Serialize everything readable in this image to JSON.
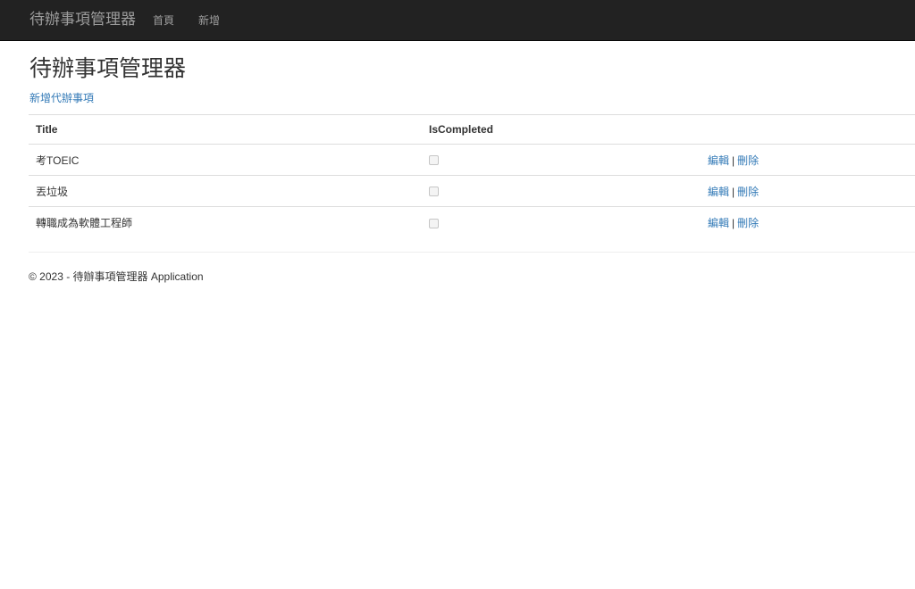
{
  "navbar": {
    "brand": "待辦事項管理器",
    "links": [
      "首頁",
      "新增"
    ]
  },
  "page": {
    "title": "待辦事項管理器",
    "create_link": "新增代辦事項"
  },
  "table": {
    "headers": [
      "Title",
      "IsCompleted"
    ],
    "rows": [
      {
        "title": "考TOEIC",
        "is_completed": false,
        "edit": "編輯",
        "sep": "|",
        "delete": "刪除"
      },
      {
        "title": "丟垃圾",
        "is_completed": false,
        "edit": "編輯",
        "sep": "|",
        "delete": "刪除"
      },
      {
        "title": "轉職成為軟體工程師",
        "is_completed": false,
        "edit": "編輯",
        "sep": "|",
        "delete": "刪除"
      }
    ]
  },
  "footer": {
    "text": "© 2023 - 待辦事項管理器 Application"
  },
  "colors": {
    "navbar_bg": "#222222",
    "nav_text": "#9d9d9d",
    "link": "#337ab7",
    "text": "#333333"
  }
}
